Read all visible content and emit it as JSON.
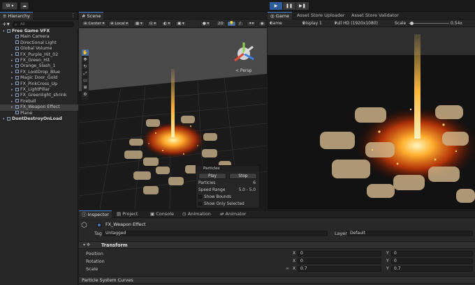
{
  "toolbar": {
    "account": "W",
    "play_icon": "play-icon",
    "pause_icon": "pause-icon",
    "step_icon": "step-icon"
  },
  "hierarchy": {
    "tab": "Hierarchy",
    "search_placeholder": "All",
    "items": [
      {
        "label": "Free Game VFX",
        "depth": 0,
        "root": true
      },
      {
        "label": "Main Camera",
        "depth": 1
      },
      {
        "label": "Directional Light",
        "depth": 1
      },
      {
        "label": "Global Volume",
        "depth": 1
      },
      {
        "label": "FX_Purple_Hit_02",
        "depth": 1
      },
      {
        "label": "FX_Green_Hit",
        "depth": 1
      },
      {
        "label": "Orange_Slash_1",
        "depth": 1
      },
      {
        "label": "FX_LootDrop_Blue",
        "depth": 1
      },
      {
        "label": "Magic Door_Gold",
        "depth": 1
      },
      {
        "label": "FX_PinkCross_Up",
        "depth": 1
      },
      {
        "label": "FX_LightPillar",
        "depth": 1
      },
      {
        "label": "FX_Greenlight_shrink",
        "depth": 1
      },
      {
        "label": "Fireball",
        "depth": 1
      },
      {
        "label": "FX_Weapon Effect",
        "depth": 1,
        "selected": true
      },
      {
        "label": "Plane",
        "depth": 1
      },
      {
        "label": "DontDestroyOnLoad",
        "depth": 0,
        "root": true
      }
    ]
  },
  "scene": {
    "tab": "Scene",
    "pivot": "Center",
    "space": "Local",
    "mode_2d": "2D",
    "persp_label": "< Persp",
    "particles": {
      "title": "Particles",
      "play": "Play",
      "stop": "Stop",
      "count_label": "Particles",
      "count_value": "6",
      "speed_label": "Speed Range",
      "speed_value": "5.0 - 5.0",
      "show_bounds": "Show Bounds",
      "show_selected": "Show Only Selected"
    }
  },
  "game": {
    "tabs": [
      "Game",
      "Asset Store Uploader",
      "Asset Store Validator"
    ],
    "mode": "Game",
    "display": "Display 1",
    "resolution": "Full HD (1920x1080)",
    "scale_label": "Scale",
    "scale_value": "0.54x"
  },
  "inspector": {
    "tabs": [
      "Inspector",
      "Project",
      "Console",
      "Animation",
      "Animator"
    ],
    "object_name": "FX_Weapon Effect",
    "tag_label": "Tag",
    "tag_value": "Untagged",
    "layer_label": "Layer",
    "layer_value": "Default",
    "component": "Transform",
    "position_label": "Position",
    "rotation_label": "Rotation",
    "scale_label": "Scale",
    "position": {
      "x": "0",
      "y": "0"
    },
    "rotation": {
      "x": "0",
      "y": "0"
    },
    "scale": {
      "x": "0.7",
      "y": "0.7"
    },
    "curves": "Particle System Curves"
  },
  "colors": {
    "accent": "#4b7ec9",
    "fire": "#ff8a1e",
    "flare": "#ffd36b"
  }
}
